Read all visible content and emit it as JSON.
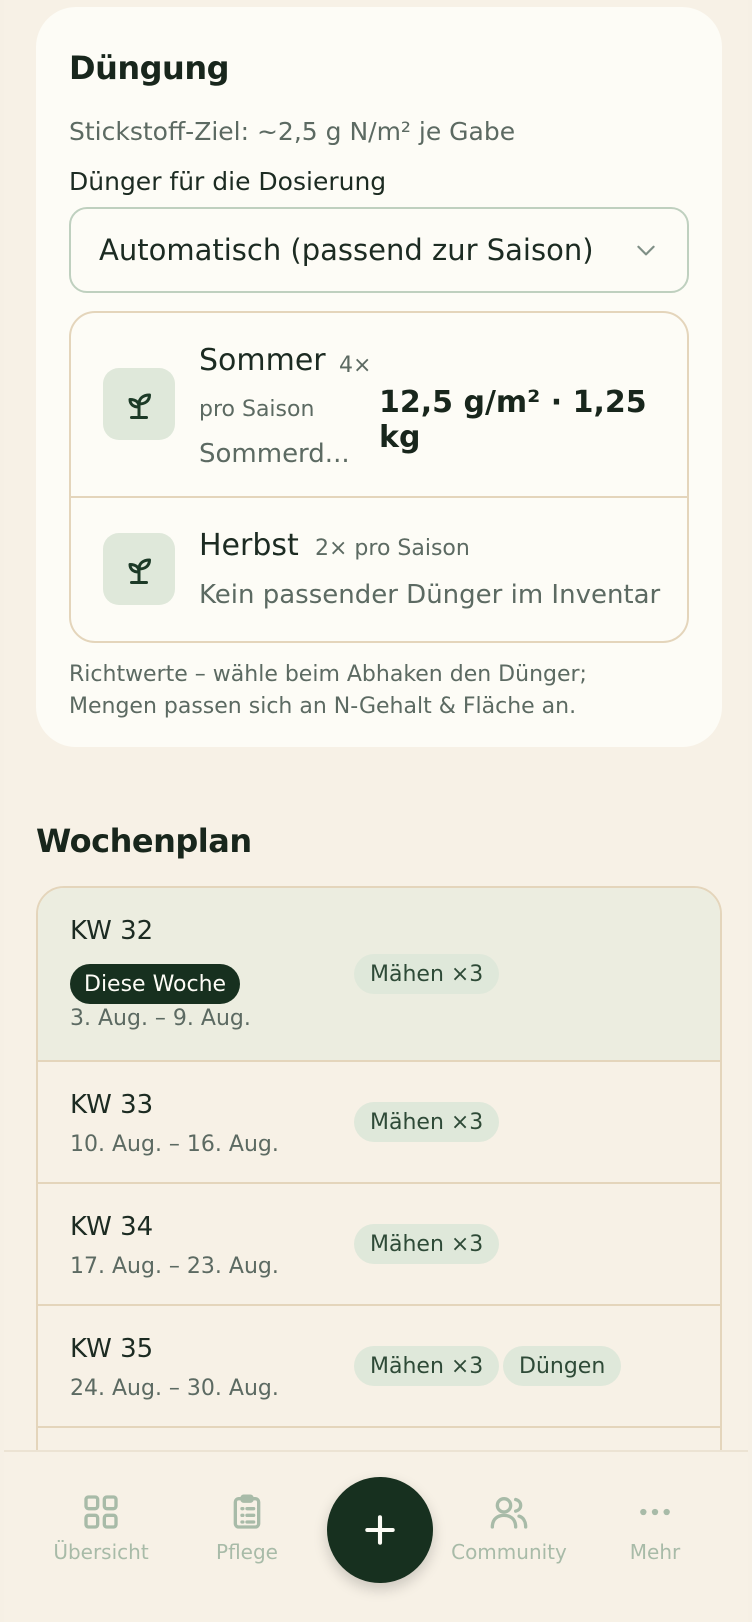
{
  "fertilizing": {
    "title": "Düngung",
    "nitrogen_target": "Stickstoff-Ziel: ~2,5 g N/m² je Gabe",
    "fertilizer_label": "Dünger für die Dosierung",
    "fertilizer_select": "Automatisch (passend zur Saison)",
    "seasons": [
      {
        "name": "Sommer",
        "freq_count": "4×",
        "freq_unit": "pro Saison",
        "dose": "12,5 g/m² · 1,25 kg",
        "product": "Sommerd..."
      },
      {
        "name": "Herbst",
        "freq": "2× pro Saison",
        "product": "Kein passender Dünger im Inventar"
      }
    ],
    "note": "Richtwerte – wähle beim Abhaken den Dünger; Mengen passen sich an N-Gehalt & Fläche an."
  },
  "weekly_plan": {
    "title": "Wochenplan",
    "current_badge": "Diese Woche",
    "weeks": [
      {
        "kw": "KW 32",
        "dates": "3. Aug. – 9. Aug.",
        "tasks": [
          "Mähen ×3"
        ]
      },
      {
        "kw": "KW 33",
        "dates": "10. Aug. – 16. Aug.",
        "tasks": [
          "Mähen ×3"
        ]
      },
      {
        "kw": "KW 34",
        "dates": "17. Aug. – 23. Aug.",
        "tasks": [
          "Mähen ×3"
        ]
      },
      {
        "kw": "KW 35",
        "dates": "24. Aug. – 30. Aug.",
        "tasks": [
          "Mähen ×3",
          "Düngen"
        ]
      }
    ]
  },
  "nav": {
    "overview": "Übersicht",
    "care": "Pflege",
    "community": "Community",
    "more": "Mehr"
  },
  "icons": {
    "season": "sprout-icon",
    "select": "chevron-down-icon",
    "overview": "grid-icon",
    "care": "clipboard-icon",
    "add": "plus-icon",
    "community": "users-icon",
    "more": "more-dots-icon"
  },
  "colors": {
    "background": "#f6f0e5",
    "card": "#fdfcf6",
    "accent_dark": "#17301f",
    "chip": "#dfe8da",
    "nav_inactive": "#a8bba8"
  }
}
